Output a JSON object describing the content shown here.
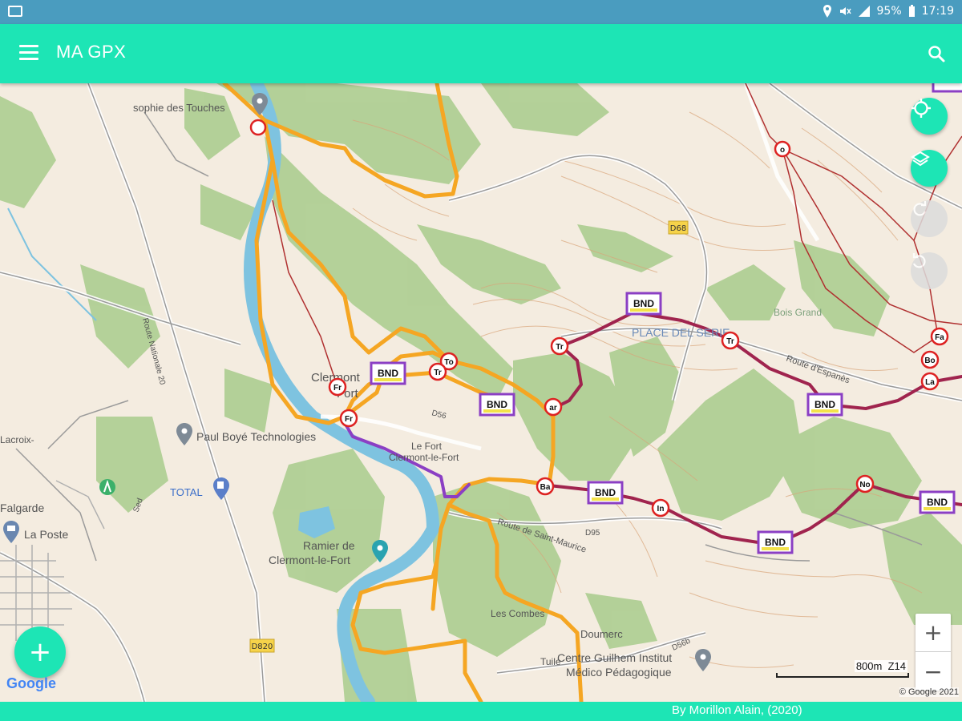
{
  "status_bar": {
    "battery": "95%",
    "time": "17:19"
  },
  "app_bar": {
    "title": "MA GPX"
  },
  "map": {
    "place_labels": {
      "sophie": "sophie des Touches",
      "clermont_fort_1": "Clermont",
      "clermont_fort_2": "Fort",
      "paul_boye": "Paul Boyé Technologies",
      "le_fort": "Le Fort",
      "clermont_le_fort": "Clermont-le-Fort",
      "total": "TOTAL",
      "la_poste": "La Poste",
      "lacroix_1": "Lacroix-",
      "lacroix_2": "Falgarde",
      "ramier_1": "Ramier de",
      "ramier_2": "Clermont-le-Fort",
      "les_combes": "Les Combes",
      "doumerc": "Doumerc",
      "centre_1": "Centre Guilhem Institut",
      "centre_2": "Médico Pédagogique",
      "place_del_serie": "PLACE DEL SERIE",
      "bois_grand": "Bois Grand",
      "route_espanes": "Route d'Espanès",
      "route_st_maurice": "Route de Saint-Maurice",
      "d68": "D68",
      "d820": "D820",
      "d56": "D56",
      "d95": "D95",
      "d56b": "D56b",
      "route_nationale": "Route Nationale 20",
      "tuile": "Tuile",
      "sed": "Sed"
    },
    "bnd_labels": [
      "BND",
      "BND",
      "BND",
      "BND",
      "BND",
      "BND",
      "BND"
    ],
    "waypoint_labels": [
      "Fr",
      "Fr",
      "To",
      "Tr",
      "Tr",
      "Ba",
      "In",
      "No",
      "Tr",
      "Fa",
      "Bo",
      "La",
      "ar",
      "o"
    ],
    "scale": {
      "distance": "800m",
      "zoom": "Z14"
    },
    "google_logo": "Google",
    "copyright": "© Google 2021",
    "colors": {
      "orange_track": "#f5a623",
      "maroon_track": "#a0244e",
      "purple_track": "#8b3fc4",
      "river": "#7ec3e0",
      "forest": "#a8cc8c",
      "accent": "#1de5b5"
    }
  },
  "buttons": {
    "my_location": "gps-fixed-icon",
    "layers": "layers-icon",
    "redo": "redo-icon",
    "undo": "undo-icon",
    "add": "+",
    "zoom_in": "+",
    "zoom_out": "−"
  },
  "footer": {
    "credit": "By Morillon Alain, (2020)"
  }
}
